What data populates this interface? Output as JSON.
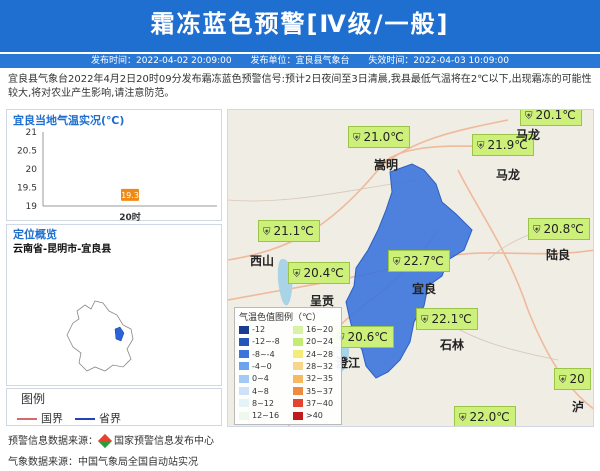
{
  "header": {
    "title": "霜冻蓝色预警[Ⅳ级/一般]",
    "publish_time": "发布时间：2022-04-02 20:09:00",
    "publish_unit": "发布单位：宜良县气象台",
    "expire_time": "失效时间：2022-04-03 10:09:00"
  },
  "description": "宜良县气象台2022年4月2日20时09分发布霜冻蓝色预警信号:预计2日夜间至3日清晨,我县最低气温将在2℃以下,出现霜冻的可能性较大,将对农业产生影响,请注意防范。",
  "temp_chart": {
    "title": "宜良当地气温实况(℃)",
    "chart_data": {
      "type": "scatter",
      "categories": [
        "20时"
      ],
      "values": [
        19.3
      ],
      "ylim": [
        19,
        21
      ],
      "yticks": [
        "21",
        "20.5",
        "20",
        "19.5",
        "19"
      ],
      "data_labels": [
        "19.3"
      ],
      "marker_color": "#f08a17"
    }
  },
  "location": {
    "title": "定位概览",
    "path": "云南省-昆明市-宜良县",
    "highlight_color": "#2a62d8"
  },
  "legend": {
    "title": "图例",
    "items": [
      {
        "label": "国界",
        "color": "#d46a6a"
      },
      {
        "label": "省界",
        "color": "#2144b8"
      }
    ]
  },
  "map": {
    "county_color": "#3c74dc",
    "stations": [
      {
        "value": "21.0℃"
      },
      {
        "value": "21.9℃"
      },
      {
        "value": "21.1℃"
      },
      {
        "value": "20.4℃"
      },
      {
        "value": "22.7℃"
      },
      {
        "value": "22.1℃"
      },
      {
        "value": "20.6℃"
      },
      {
        "value": "20.8℃"
      },
      {
        "value": "22.0℃"
      },
      {
        "value": "20.1℃"
      },
      {
        "value": "20"
      }
    ],
    "cities": [
      "嵩明",
      "马龙",
      "西山",
      "呈贡",
      "宜良",
      "陆良",
      "石林",
      "澄江",
      "马龙",
      "泸"
    ],
    "station_icon": "thermometer-station-icon",
    "color_legend": {
      "title": "气温色值图例（℃）",
      "items": [
        {
          "label": "-12",
          "color": "#1a3b8f"
        },
        {
          "label": "16~20",
          "color": "#d8f3a8"
        },
        {
          "label": "-12~-8",
          "color": "#2457b8"
        },
        {
          "label": "20~24",
          "color": "#c4ec74"
        },
        {
          "label": "-8~-4",
          "color": "#3c74dc"
        },
        {
          "label": "24~28",
          "color": "#f5ec78"
        },
        {
          "label": "-4~0",
          "color": "#6da2ee"
        },
        {
          "label": "28~32",
          "color": "#f7d58a"
        },
        {
          "label": "0~4",
          "color": "#a4c9f5"
        },
        {
          "label": "32~35",
          "color": "#f6b860"
        },
        {
          "label": "4~8",
          "color": "#cde2f9"
        },
        {
          "label": "35~37",
          "color": "#f08a3c"
        },
        {
          "label": "8~12",
          "color": "#e6f3f6"
        },
        {
          "label": "37~40",
          "color": "#e6432e"
        },
        {
          "label": "12~16",
          "color": "#eef8ec"
        },
        {
          "label": ">40",
          "color": "#c21a1a"
        }
      ]
    }
  },
  "footer": {
    "warning_source_label": "预警信息数据来源：",
    "warning_source": "国家预警信息发布中心",
    "weather_source": "气象数据来源：中国气象局全国自动站实况"
  }
}
